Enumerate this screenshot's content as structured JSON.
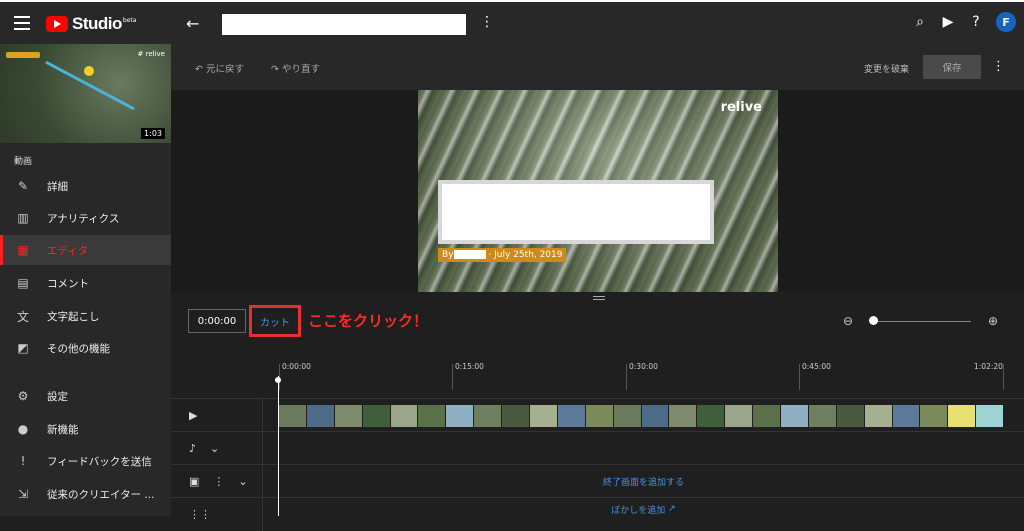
{
  "header": {
    "brand": "Studio",
    "beta": "beta",
    "avatar_initial": "F",
    "icons": [
      "menu-icon",
      "back-arrow-icon",
      "more-vert-icon",
      "search-icon",
      "create-video-icon",
      "help-icon"
    ]
  },
  "sidebar": {
    "thumbnail": {
      "tag": "# relive",
      "duration": "1:03"
    },
    "section_label": "動画",
    "items": [
      {
        "label": "詳細",
        "icon": "✎"
      },
      {
        "label": "アナリティクス",
        "icon": "▥"
      },
      {
        "label": "エディタ",
        "icon": "▦"
      },
      {
        "label": "コメント",
        "icon": "▤"
      },
      {
        "label": "文字起こし",
        "icon": "文"
      },
      {
        "label": "その他の機能",
        "icon": "◩"
      },
      {
        "label": "設定",
        "icon": "⚙"
      },
      {
        "label": "新機能",
        "icon": "●"
      },
      {
        "label": "フィードバックを送信",
        "icon": "!"
      },
      {
        "label": "従来のクリエイター ...",
        "icon": "⇲"
      }
    ]
  },
  "editor": {
    "undo": "元に戻す",
    "redo": "やり直す",
    "discard": "変更を破棄",
    "save": "保存",
    "video": {
      "logo": "relive",
      "byline_prefix": "By",
      "byline_date": "· July 25th, 2019"
    },
    "timecode": "0:00:00",
    "cut": "カット",
    "annotation": "ここをクリック！",
    "ruler": [
      "0:00:00",
      "0:15:00",
      "0:30:00",
      "0:45:00",
      "1:02:20"
    ],
    "end_screen": "終了画面を追加する",
    "blur": "ぼかしを追加"
  },
  "colors": {
    "accent_red": "#ff2222",
    "link_blue": "#4a90e2",
    "avatar": "#1565c0"
  }
}
